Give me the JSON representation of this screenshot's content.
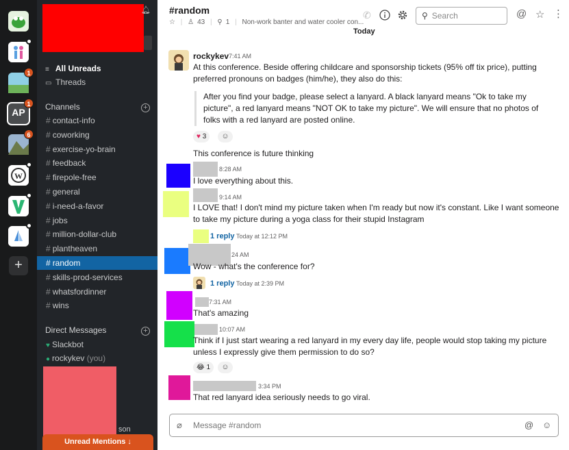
{
  "sidebar": {
    "nav": [
      {
        "label": "All Unreads",
        "icon": "all-unreads-icon"
      },
      {
        "label": "Threads",
        "icon": "threads-icon"
      }
    ],
    "channels_header": "Channels",
    "channels": [
      "contact-info",
      "coworking",
      "exercise-yo-brain",
      "feedback",
      "firepole-free",
      "general",
      "i-need-a-favor",
      "jobs",
      "million-dollar-club",
      "plantheaven",
      "random",
      "skills-prod-services",
      "whatsfordinner",
      "wins"
    ],
    "active_channel": "random",
    "dm_header": "Direct Messages",
    "dms": [
      {
        "name": "Slackbot"
      },
      {
        "name": "rockykev",
        "suffix": "(you)"
      }
    ],
    "partial_text": "son",
    "unread_mentions": "Unread Mentions ↓"
  },
  "workspaces": {
    "badges": [
      "1",
      "1",
      "6"
    ],
    "ap_label": "AP",
    "add": "+"
  },
  "header": {
    "title": "#random",
    "members": "43",
    "pinned": "1",
    "topic": "Non-work banter and water cooler con...",
    "search_placeholder": "Search"
  },
  "date_divider": "Today",
  "messages": [
    {
      "name": "rockykev",
      "time": "7:41 AM",
      "text": "At this conference. Beside offering childcare and sponsorship tickets (95% off tix price), putting preferred pronouns on badges (him/he), they also do this:",
      "quote": "After you find your badge, please select a lanyard. A black lanyard means \"Ok to take my picture\", a red lanyard means \"NOT OK to take my picture\". We will ensure that no photos of folks with a red lanyard are posted online.",
      "reaction": "3",
      "followup": "This conference is future thinking"
    },
    {
      "time": "8:28 AM",
      "text": "I love everything about this."
    },
    {
      "time": "9:14 AM",
      "text": "I LOVE that! I don't mind my picture taken when I'm ready but now it's constant. Like I want someone to take my picture during a yoga class for their stupid Instagram",
      "reply": "1 reply",
      "reply_time": "Today at 12:12 PM"
    },
    {
      "time": "24 AM",
      "text": "Wow - what's the conference for?",
      "reply": "1 reply",
      "reply_time": "Today at 2:39 PM"
    },
    {
      "time": "7:31 AM",
      "text": "That's amazing"
    },
    {
      "time": "10:07 AM",
      "text": "Think if I just start wearing a red lanyard in my every day life, people would stop taking my picture unless I expressly give them permission to do so?",
      "reaction": "1"
    },
    {
      "time": "3:34 PM",
      "text": "That red lanyard idea seriously needs to go viral."
    }
  ],
  "composer": {
    "placeholder": "Message #random"
  },
  "colors": {
    "sidebar_bg": "#222529",
    "rail_bg": "#191a1b",
    "active": "#1264a3",
    "link": "#1264a3",
    "badge": "#d9531e"
  }
}
